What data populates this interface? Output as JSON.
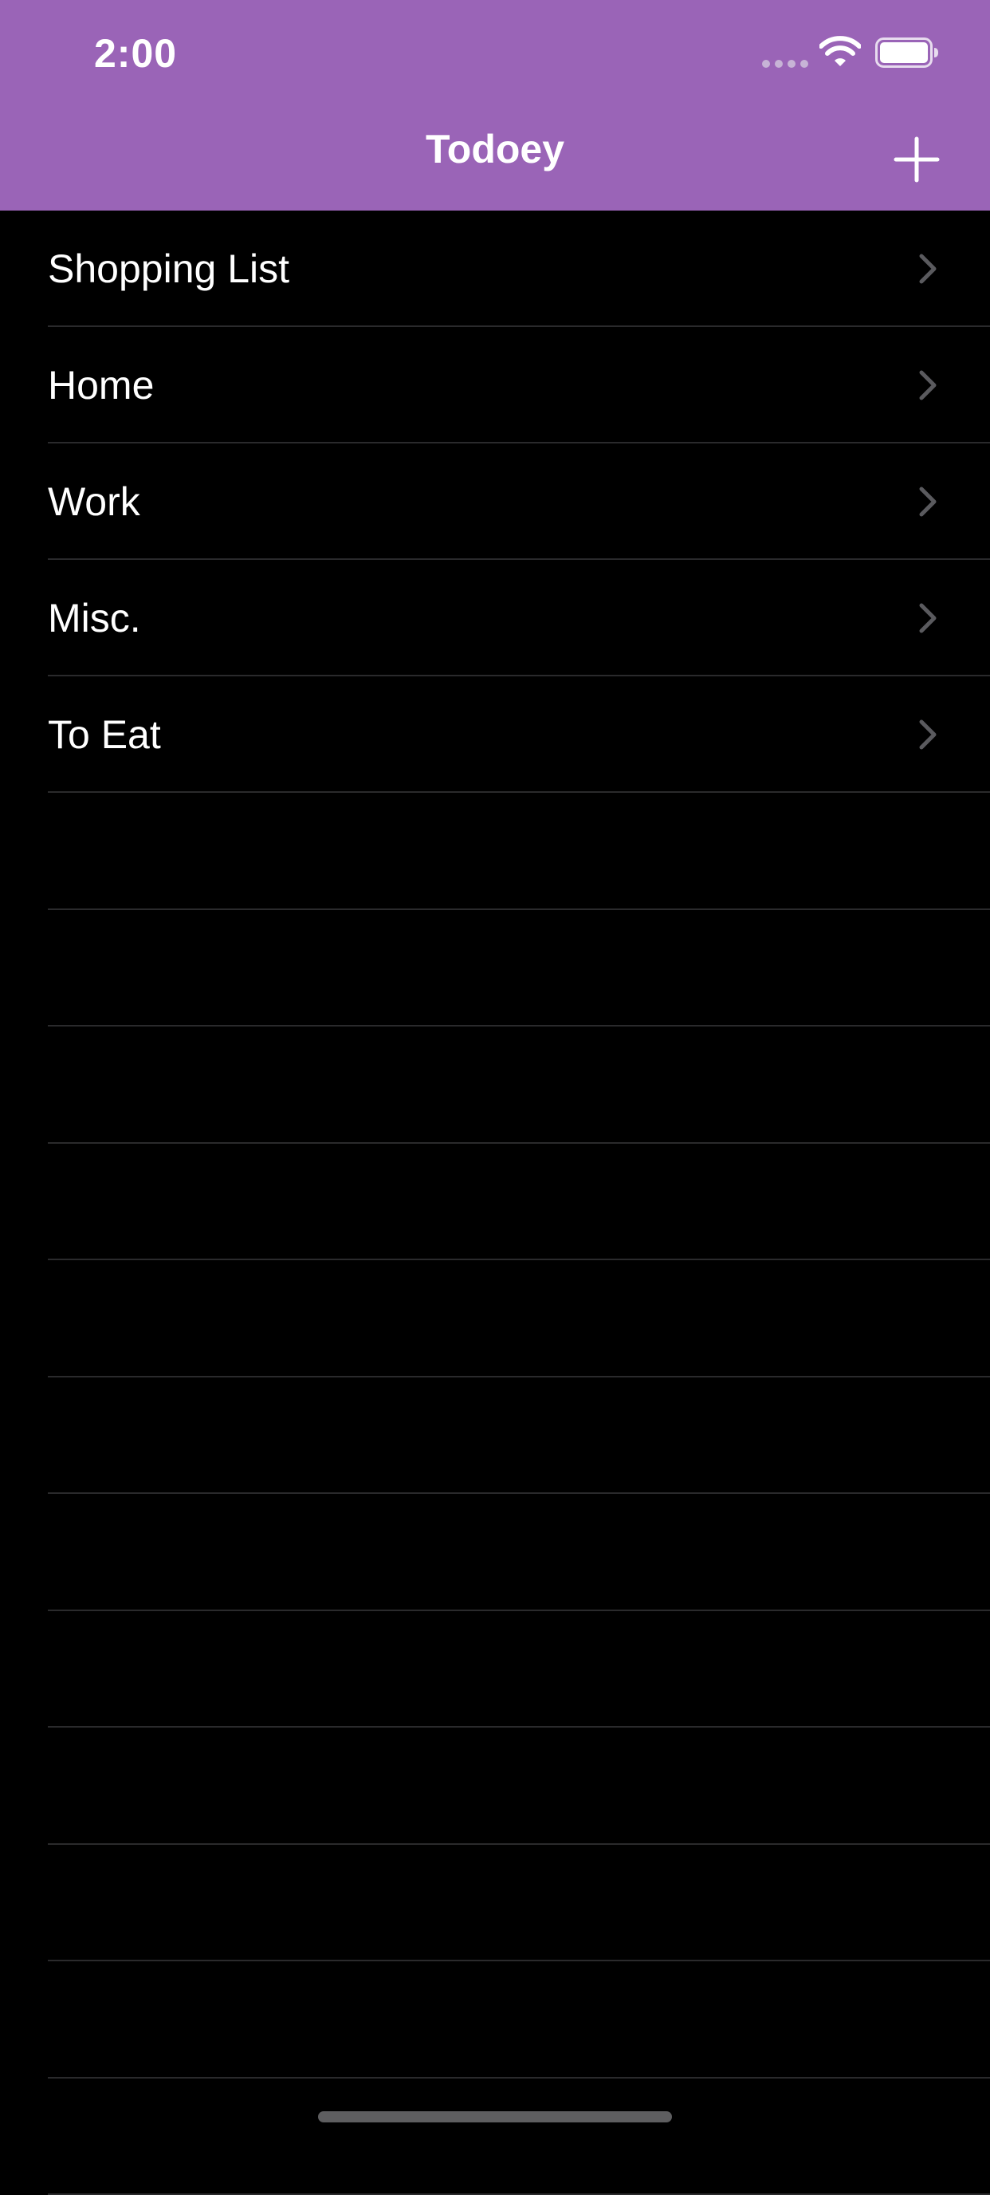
{
  "status_bar": {
    "time": "2:00",
    "icons": [
      "cellular-signal-icon",
      "wifi-icon",
      "battery-icon"
    ]
  },
  "navigation": {
    "title": "Todoey",
    "add_icon": "plus-icon",
    "bar_color": "#9a64b7"
  },
  "categories": [
    {
      "label": "Shopping List",
      "icon": "chevron-right-icon"
    },
    {
      "label": "Home",
      "icon": "chevron-right-icon"
    },
    {
      "label": "Work",
      "icon": "chevron-right-icon"
    },
    {
      "label": "Misc.",
      "icon": "chevron-right-icon"
    },
    {
      "label": "To Eat",
      "icon": "chevron-right-icon"
    }
  ],
  "theme": {
    "background": "#000000",
    "separator": "#2a2a2c",
    "chevron": "#5a5a5e"
  }
}
